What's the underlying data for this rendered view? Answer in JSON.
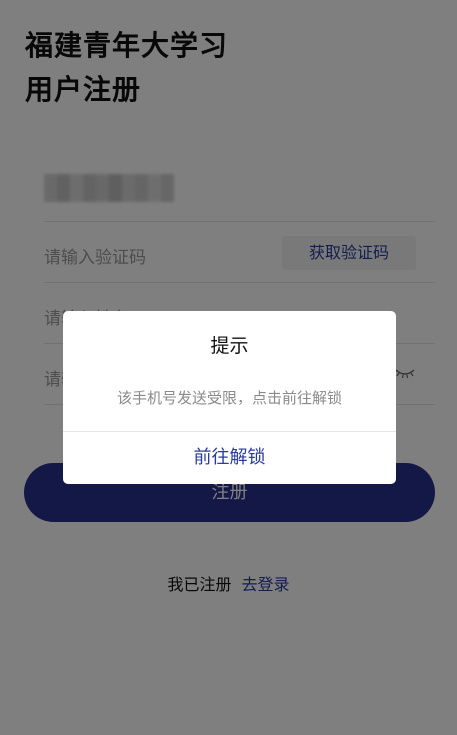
{
  "header": {
    "title_line1": "福建青年大学习",
    "title_line2": "用户注册"
  },
  "form": {
    "phone_value": "",
    "code_placeholder": "请输入验证码",
    "get_code_label": "获取验证码",
    "name_placeholder": "请输入姓名",
    "password_placeholder": "请输入密码",
    "register_label": "注册"
  },
  "footer": {
    "already_registered": "我已注册",
    "go_login": "去登录"
  },
  "dialog": {
    "title": "提示",
    "message": "该手机号发送受限，点击前往解锁",
    "action_label": "前往解锁"
  },
  "colors": {
    "accent": "#27318f",
    "link": "#2b3aa0",
    "overlay": "rgba(0,0,0,0.5)"
  }
}
